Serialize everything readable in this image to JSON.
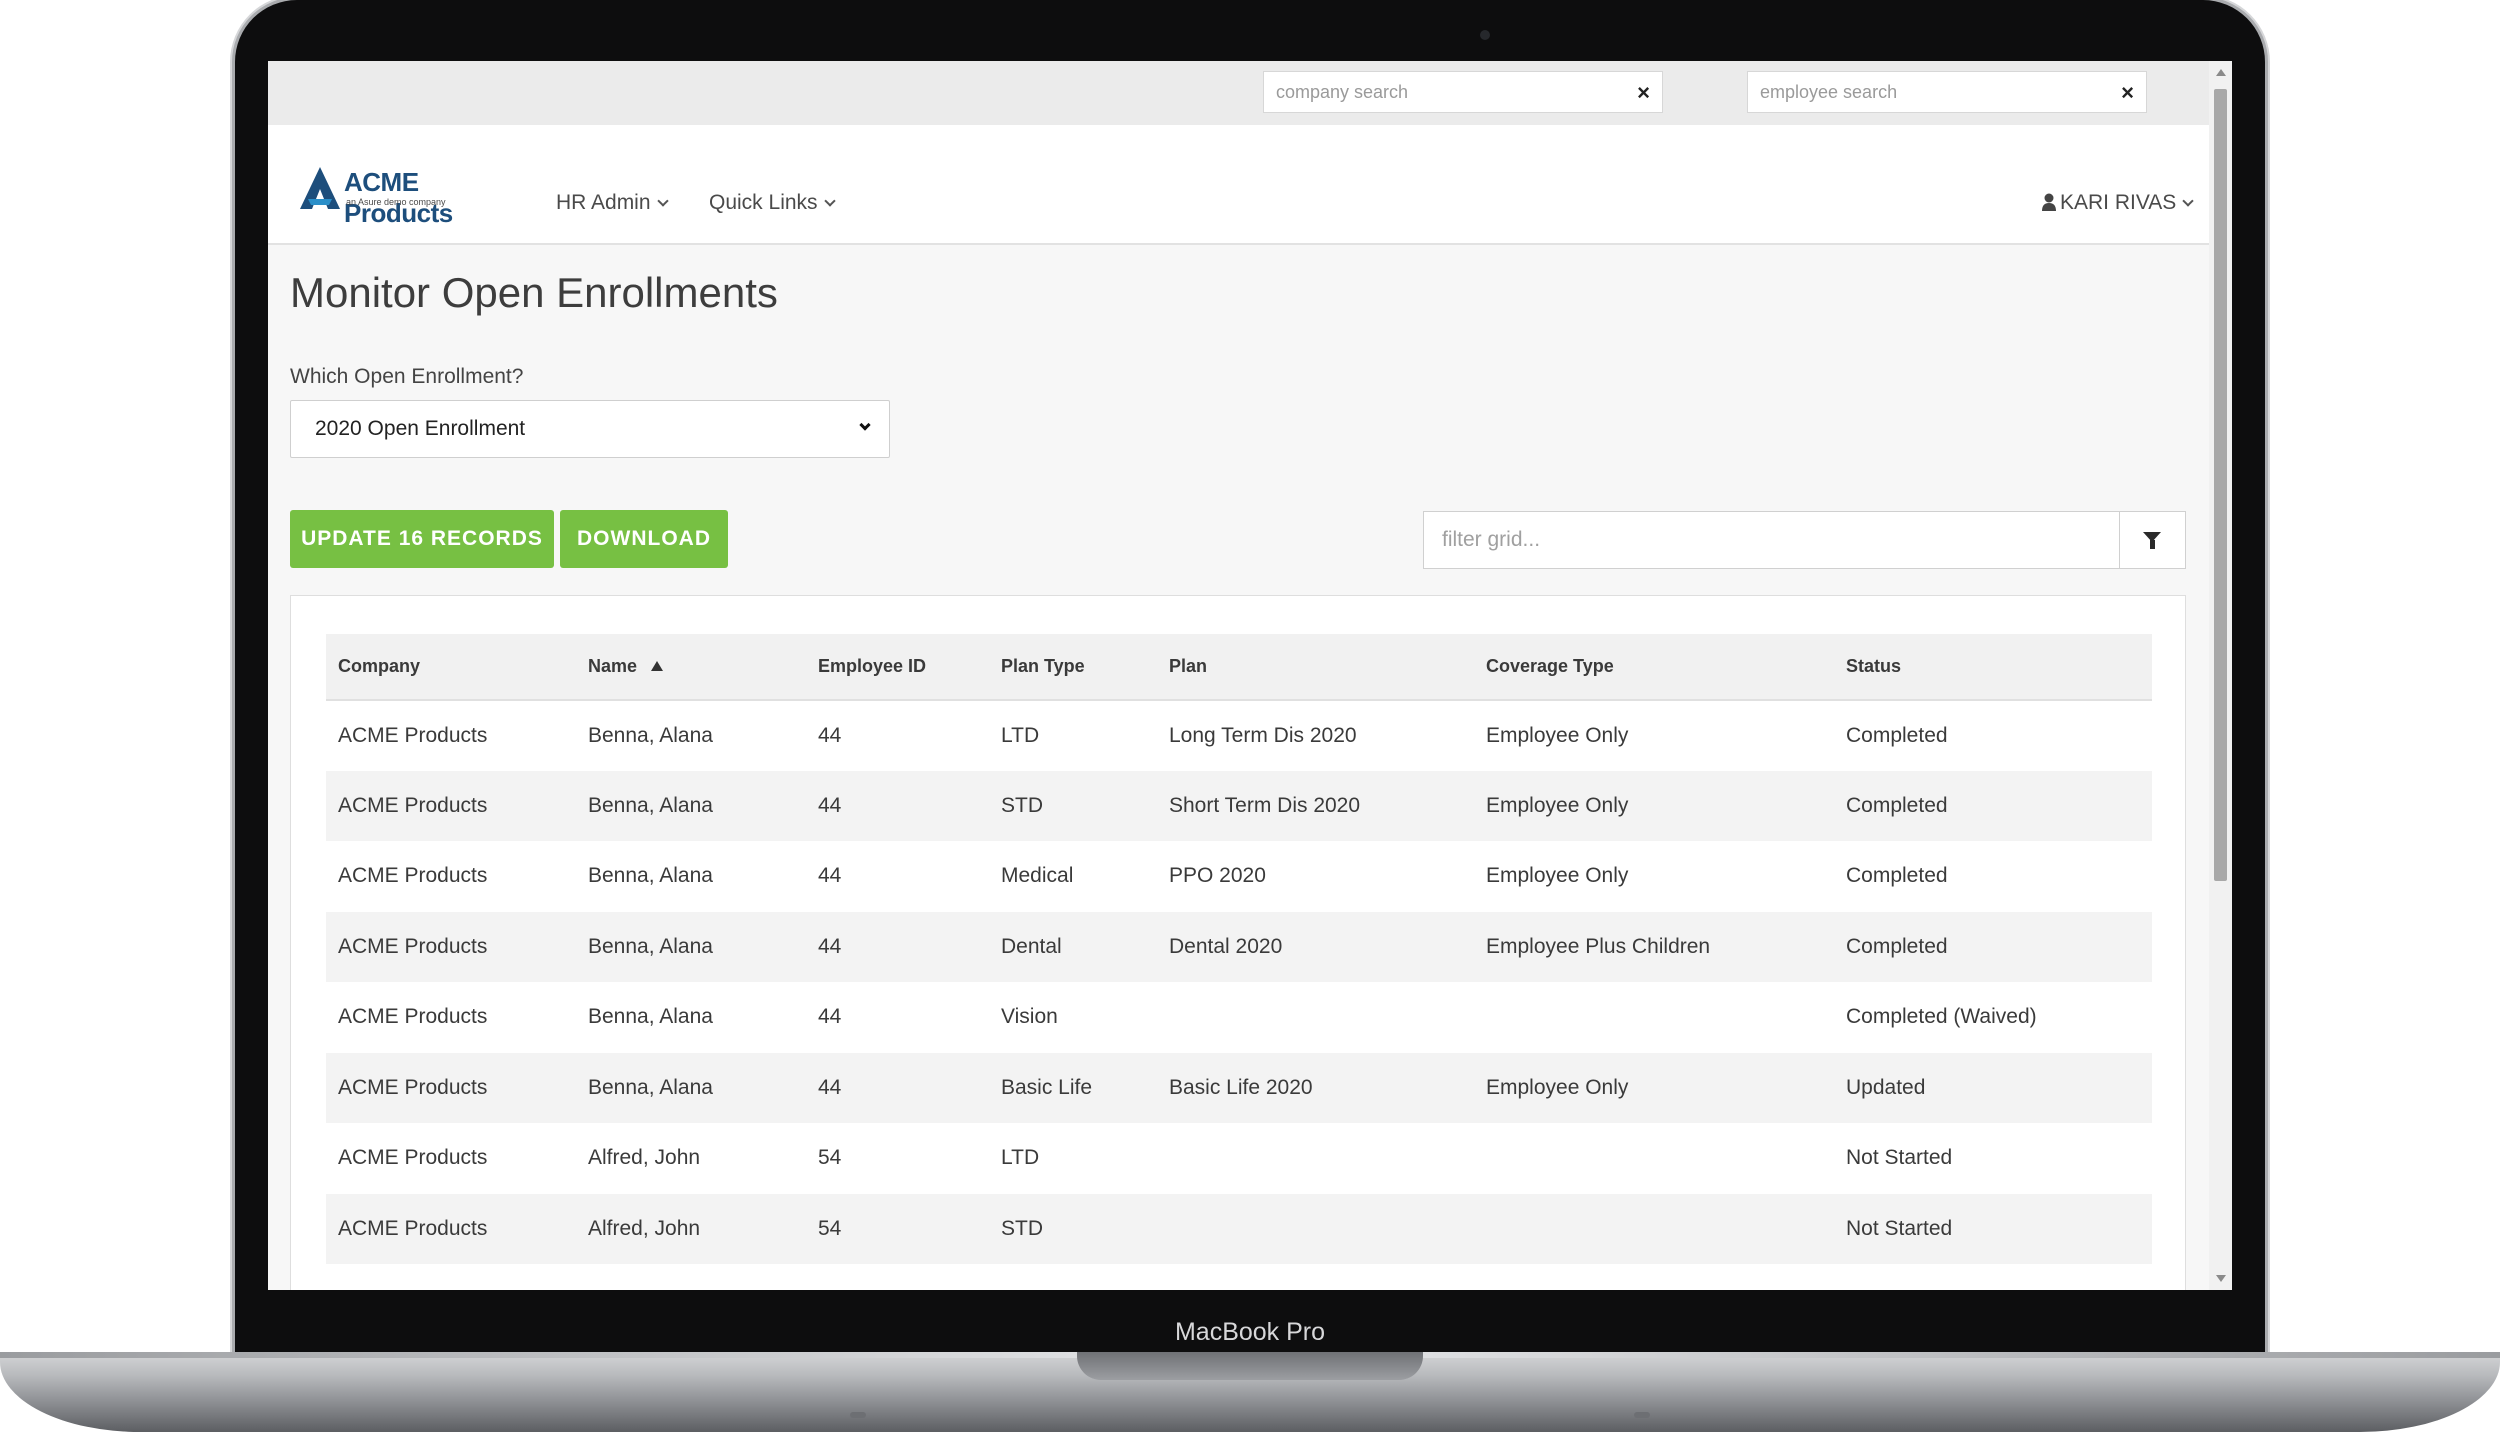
{
  "device": {
    "label": "MacBook Pro"
  },
  "search": {
    "company_placeholder": "company search",
    "employee_placeholder": "employee search",
    "clear_glyph": "×"
  },
  "brand": {
    "title": "ACME Products",
    "subtitle": "an Asure demo company",
    "colors": {
      "primary": "#1d4e7c",
      "accent": "#2a8fc9"
    }
  },
  "nav": {
    "items": [
      {
        "label": "HR Admin"
      },
      {
        "label": "Quick Links"
      }
    ],
    "user": "KARI RIVAS"
  },
  "page": {
    "title": "Monitor Open Enrollments",
    "enrollment_label": "Which Open Enrollment?",
    "enrollment_selected": "2020 Open Enrollment"
  },
  "toolbar": {
    "update_label": "UPDATE 16 RECORDS",
    "download_label": "DOWNLOAD",
    "filter_placeholder": "filter grid...",
    "button_color": "#77c043"
  },
  "grid": {
    "columns": [
      "Company",
      "Name",
      "Employee ID",
      "Plan Type",
      "Plan",
      "Coverage Type",
      "Status"
    ],
    "sort_column": "Name",
    "sort_direction": "ascending",
    "rows": [
      [
        "ACME Products",
        "Benna, Alana",
        "44",
        "LTD",
        "Long Term Dis 2020",
        "Employee Only",
        "Completed"
      ],
      [
        "ACME Products",
        "Benna, Alana",
        "44",
        "STD",
        "Short Term Dis 2020",
        "Employee Only",
        "Completed"
      ],
      [
        "ACME Products",
        "Benna, Alana",
        "44",
        "Medical",
        "PPO 2020",
        "Employee Only",
        "Completed"
      ],
      [
        "ACME Products",
        "Benna, Alana",
        "44",
        "Dental",
        "Dental 2020",
        "Employee Plus Children",
        "Completed"
      ],
      [
        "ACME Products",
        "Benna, Alana",
        "44",
        "Vision",
        "",
        "",
        "Completed (Waived)"
      ],
      [
        "ACME Products",
        "Benna, Alana",
        "44",
        "Basic Life",
        "Basic Life 2020",
        "Employee Only",
        "Updated"
      ],
      [
        "ACME Products",
        "Alfred, John",
        "54",
        "LTD",
        "",
        "",
        "Not Started"
      ],
      [
        "ACME Products",
        "Alfred, John",
        "54",
        "STD",
        "",
        "",
        "Not Started"
      ]
    ]
  }
}
